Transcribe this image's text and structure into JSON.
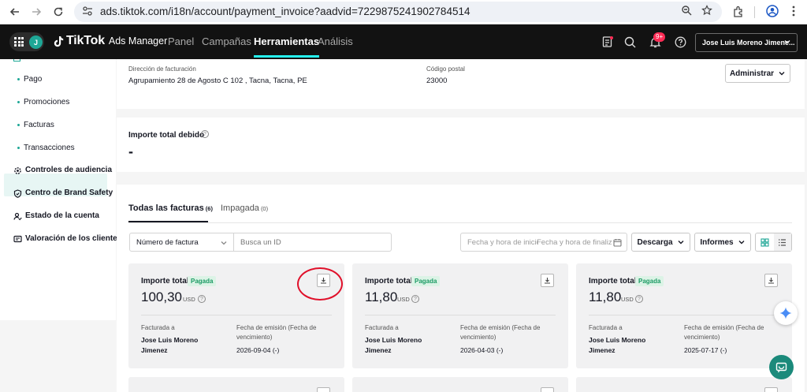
{
  "browser": {
    "url": "ads.tiktok.com/i18n/account/payment_invoice?aadvid=7229875241902784514"
  },
  "header": {
    "avatar_letter": "J",
    "brand": "TikTok",
    "product": "Ads Manager",
    "nav": [
      {
        "label": "Panel",
        "active": false
      },
      {
        "label": "Campañas",
        "active": false
      },
      {
        "label": "Herramientas",
        "active": true
      },
      {
        "label": "Análisis",
        "active": false
      }
    ],
    "notif_count": "9+",
    "account_name": "Jose Luis Moreno Jimene..."
  },
  "sidebar": {
    "sub_items": [
      {
        "label": "Pago",
        "active": false
      },
      {
        "label": "Promociones",
        "active": false
      },
      {
        "label": "Facturas",
        "active": true
      },
      {
        "label": "Transacciones",
        "active": false
      }
    ],
    "main_items": [
      {
        "label": "Controles de audiencia",
        "icon": "gear-icon"
      },
      {
        "label": "Centro de Brand Safety",
        "icon": "shield-icon"
      },
      {
        "label": "Estado de la cuenta",
        "icon": "account-status-icon"
      },
      {
        "label": "Valoración de los clientes",
        "icon": "feedback-icon"
      }
    ]
  },
  "billing": {
    "address_label": "Dirección de facturación",
    "address_value": "Agrupamiento 28 de Agosto C 102 , Tacna, Tacna, PE",
    "postal_label": "Código postal",
    "postal_value": "23000",
    "manage_button": "Administrar"
  },
  "amount_due": {
    "label": "Importe total debido",
    "value": "-"
  },
  "tabs": [
    {
      "label": "Todas las facturas",
      "count": "(6)",
      "active": true
    },
    {
      "label": "Impagada",
      "count": "(0)",
      "active": false
    }
  ],
  "filters": {
    "search_type": "Número de factura",
    "search_placeholder": "Busca un ID",
    "start_placeholder": "Fecha y hora de inicio",
    "end_placeholder": "Fecha y hora de finalización",
    "download_button": "Descarga",
    "reports_button": "Informes"
  },
  "invoices": [
    {
      "title": "Importe total",
      "status": "Pagada",
      "amount": "100,30",
      "currency": "USD",
      "billed_label": "Facturada a",
      "billed_name": "Jose Luis Moreno Jimenez",
      "date_label": "Fecha de emisión (Fecha de vencimiento)",
      "date_value": "2026-09-04 (-)"
    },
    {
      "title": "Importe total",
      "status": "Pagada",
      "amount": "11,80",
      "currency": "USD",
      "billed_label": "Facturada a",
      "billed_name": "Jose Luis Moreno Jimenez",
      "date_label": "Fecha de emisión (Fecha de vencimiento)",
      "date_value": "2026-04-03 (-)"
    },
    {
      "title": "Importe total",
      "status": "Pagada",
      "amount": "11,80",
      "currency": "USD",
      "billed_label": "Facturada a",
      "billed_name": "Jose Luis Moreno Jimenez",
      "date_label": "Fecha de emisión (Fecha de vencimiento)",
      "date_value": "2025-07-17 (-)"
    }
  ],
  "colors": {
    "accent": "#1ea796",
    "header_bg": "#121212",
    "paid_badge": "#1a9a63",
    "annotation_circle": "#e0102a"
  }
}
